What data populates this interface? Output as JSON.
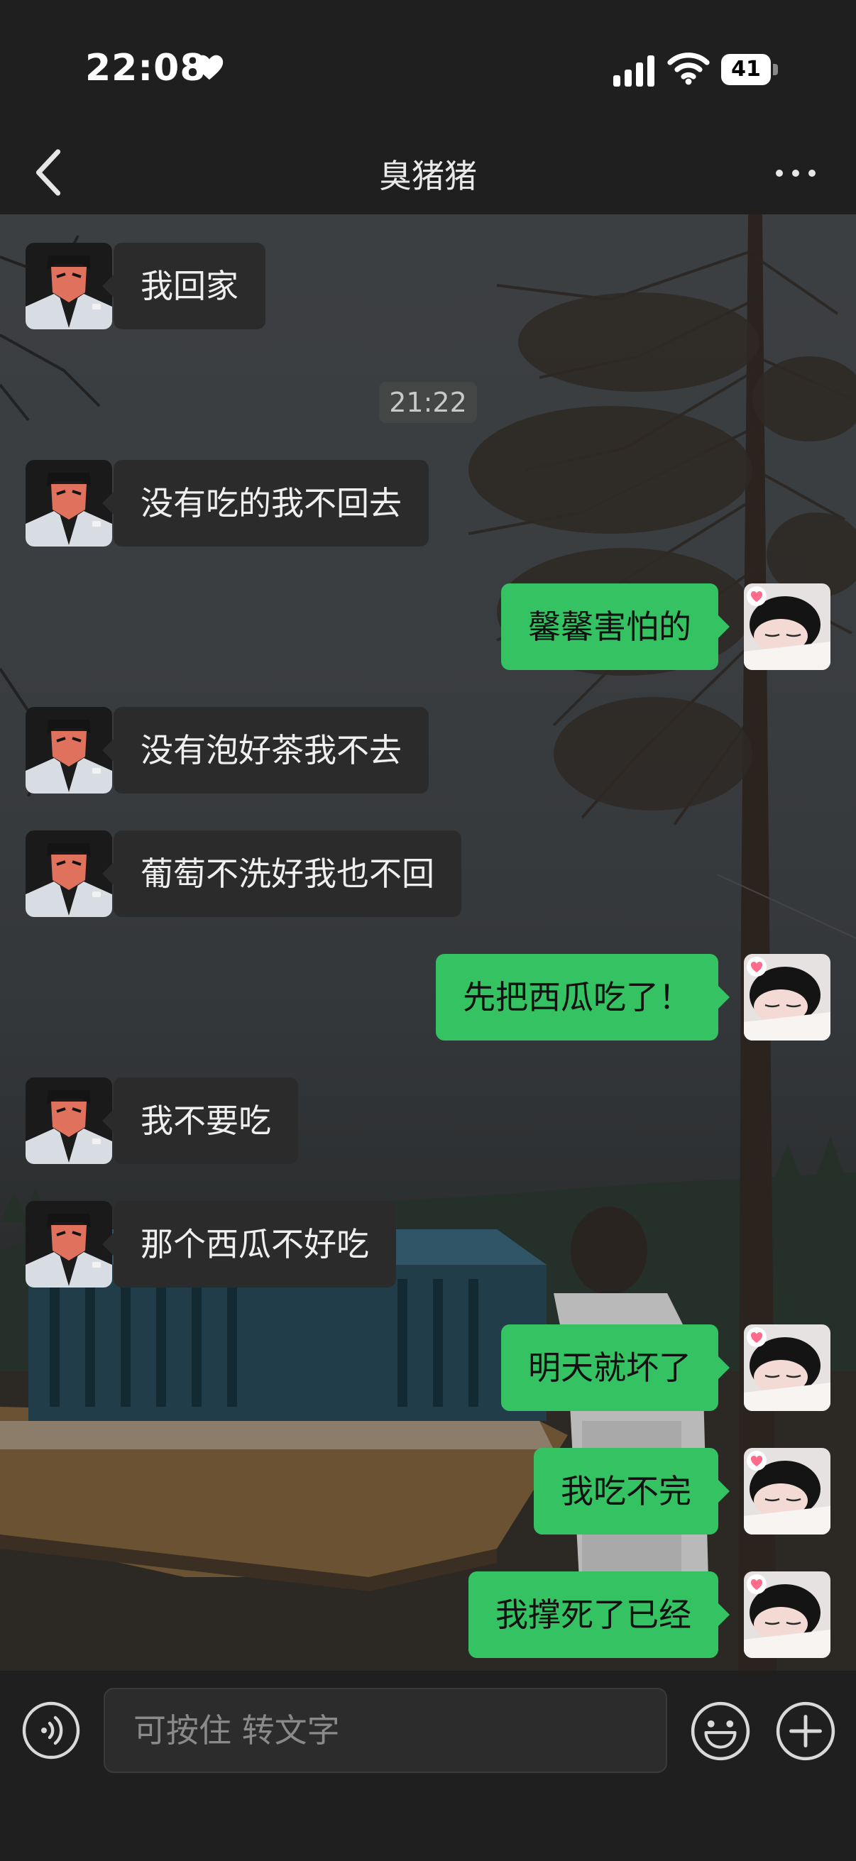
{
  "status_bar": {
    "time": "22:08",
    "battery": "41"
  },
  "header": {
    "title": "臭猪猪"
  },
  "messages": [
    {
      "side": "left",
      "text": "我回家"
    },
    {
      "side": "left",
      "text": "没有吃的我不回去"
    },
    {
      "side": "right",
      "text": "馨馨害怕的"
    },
    {
      "side": "left",
      "text": "没有泡好茶我不去"
    },
    {
      "side": "left",
      "text": "葡萄不洗好我也不回"
    },
    {
      "side": "right",
      "text": "先把西瓜吃了！"
    },
    {
      "side": "left",
      "text": "我不要吃"
    },
    {
      "side": "left",
      "text": "那个西瓜不好吃"
    },
    {
      "side": "right",
      "text": "明天就坏了"
    },
    {
      "side": "right",
      "text": "我吃不完"
    },
    {
      "side": "right",
      "text": "我撑死了已经"
    }
  ],
  "timestamp": "21:22",
  "input": {
    "placeholder": "可按住 转文字"
  },
  "colors": {
    "sent_bubble": "#35c263",
    "received_bubble": "#2b2b2b",
    "bar": "#1f1f1f"
  }
}
